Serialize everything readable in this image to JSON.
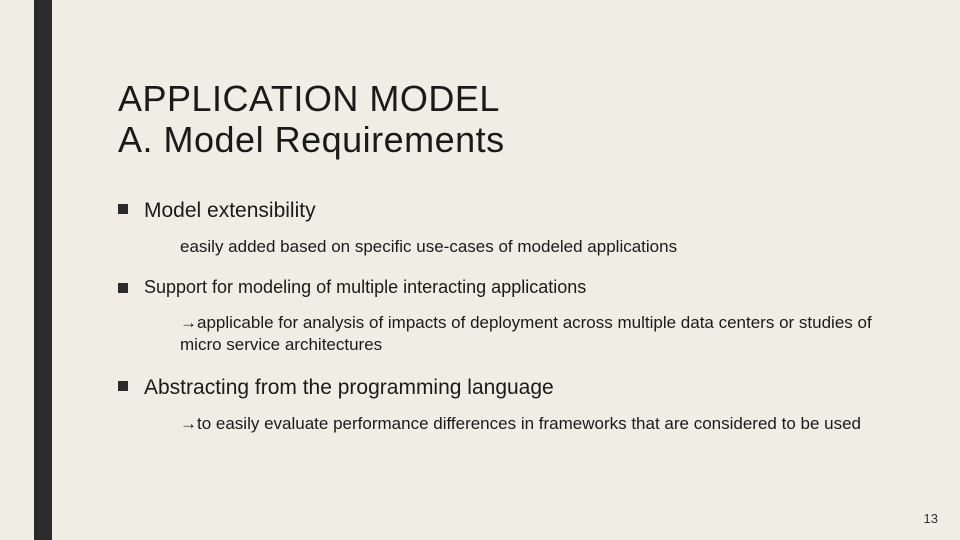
{
  "title": {
    "line1": "APPLICATION MODEL",
    "line2": "A. Model Requirements"
  },
  "bullets": [
    {
      "label": "Model extensibility",
      "size": "main",
      "detail": "easily added based on specific use-cases of modeled applications"
    },
    {
      "label": "Support for modeling of multiple interacting applications",
      "size": "sub",
      "detail": "→applicable for analysis of impacts of deployment across multiple data centers or studies of micro service architectures"
    },
    {
      "label": "Abstracting from the programming language",
      "size": "main",
      "detail": "→to easily evaluate performance differences in frameworks that are considered to be used"
    }
  ],
  "page_number": "13"
}
